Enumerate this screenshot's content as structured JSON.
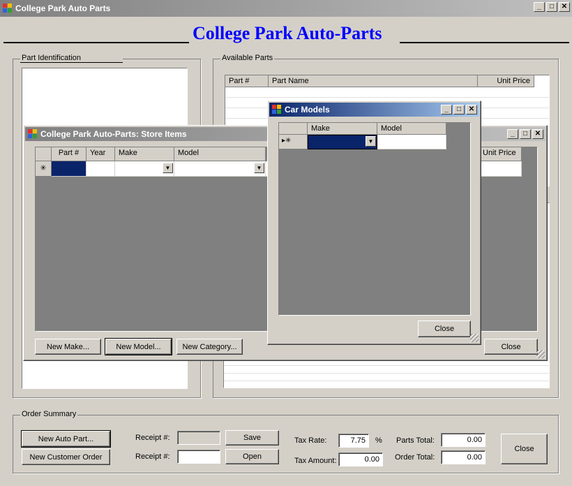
{
  "main_window": {
    "title": "College Park Auto Parts",
    "heading": "College Park Auto-Parts",
    "part_identification": {
      "label": "Part Identification"
    },
    "available_parts": {
      "label": "Available Parts",
      "columns": [
        "Part #",
        "Part Name",
        "Unit Price"
      ]
    },
    "order_summary": {
      "label": "Order Summary",
      "new_auto_part": "New Auto Part...",
      "new_customer_order": "New Customer Order",
      "receipt_label_1": "Receipt #:",
      "receipt_label_2": "Receipt #:",
      "save": "Save",
      "open": "Open",
      "tax_rate_label": "Tax Rate:",
      "tax_rate_value": "7.75",
      "percent": "%",
      "tax_amount_label": "Tax Amount:",
      "tax_amount_value": "0.00",
      "parts_total_label": "Parts Total:",
      "parts_total_value": "0.00",
      "order_total_label": "Order Total:",
      "order_total_value": "0.00",
      "close": "Close"
    }
  },
  "store_items_window": {
    "title": "College Park Auto-Parts: Store Items",
    "columns": [
      "Part #",
      "Year",
      "Make",
      "Model",
      "Unit Price"
    ],
    "new_row_marker": "✳",
    "new_make": "New Make...",
    "new_model": "New Model...",
    "new_category": "New Category...",
    "close": "Close"
  },
  "car_models_window": {
    "title": "Car Models",
    "columns": [
      "Make",
      "Model"
    ],
    "row_marker": "▸✳",
    "close": "Close"
  },
  "caption_glyphs": {
    "minimize": "_",
    "maximize": "□",
    "close": "✕"
  }
}
